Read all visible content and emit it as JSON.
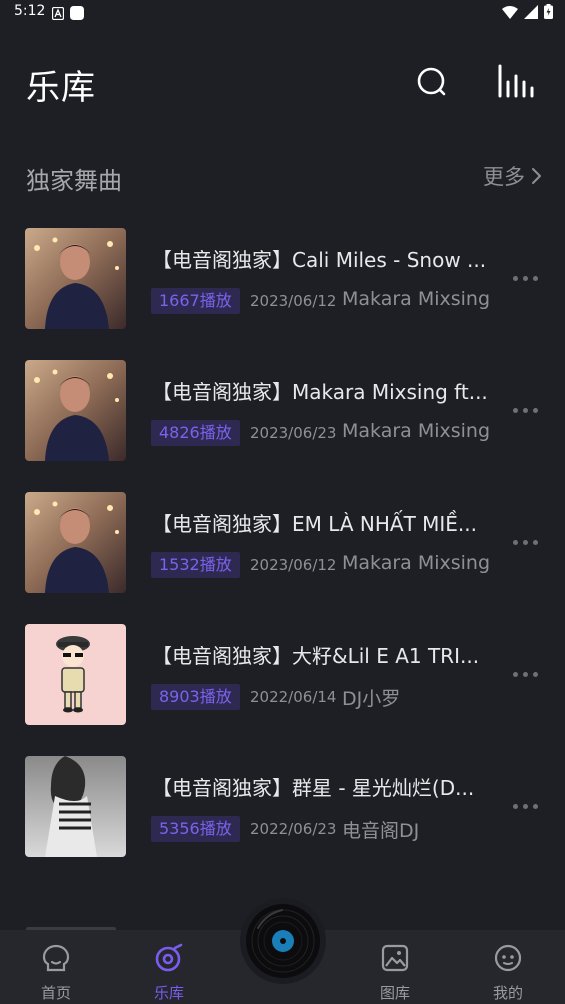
{
  "status_bar": {
    "time": "5:12"
  },
  "header": {
    "title": "乐库"
  },
  "section": {
    "title": "独家舞曲",
    "more_label": "更多"
  },
  "songs": [
    {
      "title": "【电音阁独家】Cali Miles - Snow ...",
      "plays": "1667播放",
      "date": "2023/06/12",
      "artist": "Makara Mixsing"
    },
    {
      "title": "【电音阁独家】Makara Mixsing ft...",
      "plays": "4826播放",
      "date": "2023/06/23",
      "artist": "Makara Mixsing"
    },
    {
      "title": "【电音阁独家】EM LÀ NHẤT MIỀ...",
      "plays": "1532播放",
      "date": "2023/06/12",
      "artist": "Makara Mixsing"
    },
    {
      "title": "【电音阁独家】大籽&Lil E A1 TRI...",
      "plays": "8903播放",
      "date": "2022/06/14",
      "artist": "DJ小罗"
    },
    {
      "title": "【电音阁独家】群星 - 星光灿烂(D...",
      "plays": "5356播放",
      "date": "2022/06/23",
      "artist": "电音阁DJ"
    }
  ],
  "tabs": [
    {
      "label": "首页",
      "icon": "home-icon"
    },
    {
      "label": "乐库",
      "icon": "music-library-icon",
      "active": true
    },
    {
      "label": "图库",
      "icon": "gallery-icon"
    },
    {
      "label": "我的",
      "icon": "profile-icon"
    }
  ],
  "colors": {
    "background": "#1e1f24",
    "accent": "#7a5cf0",
    "badge_bg": "#2e2950",
    "tab_bar": "#26272c"
  }
}
